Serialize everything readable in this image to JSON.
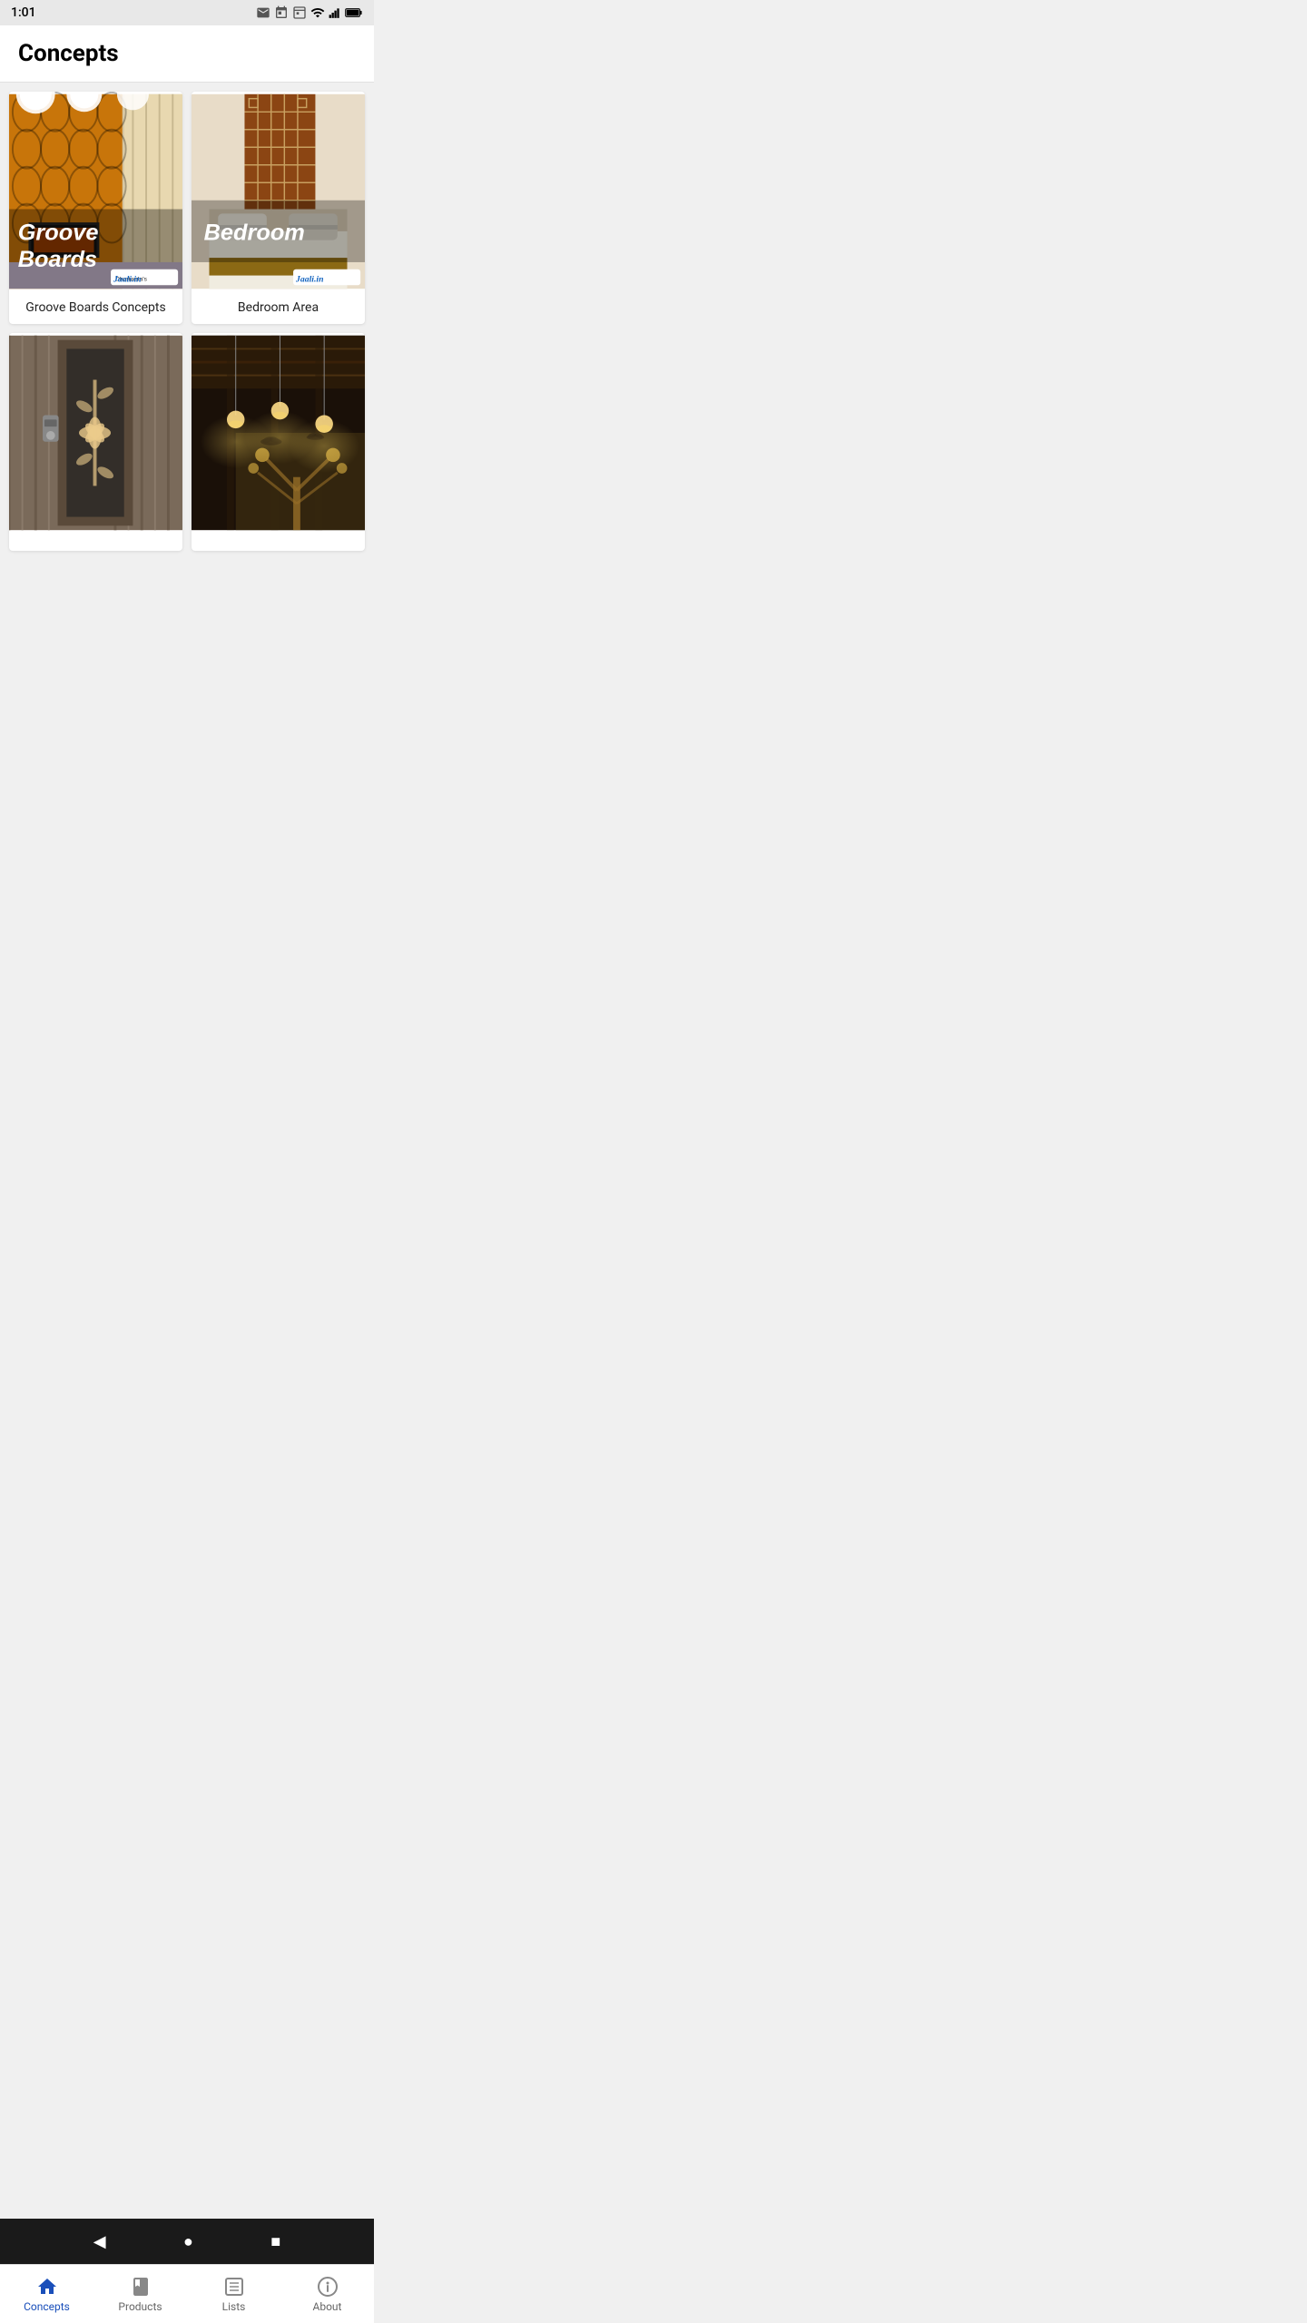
{
  "statusBar": {
    "time": "1:01",
    "icons": [
      "gmail",
      "calendar",
      "calendar2",
      "wifi",
      "signal",
      "battery"
    ]
  },
  "header": {
    "title": "Concepts"
  },
  "cards": [
    {
      "id": "groove-boards",
      "overlayText": "Groove\nBoards",
      "label": "Groove Boards Concepts",
      "badge": "Jaali.in",
      "type": "groove"
    },
    {
      "id": "bedroom-area",
      "overlayText": "Bedroom",
      "label": "Bedroom Area",
      "badge": "Jaali.in",
      "type": "bedroom"
    },
    {
      "id": "door-concept",
      "overlayText": "",
      "label": "",
      "badge": "",
      "type": "door"
    },
    {
      "id": "ceiling-concept",
      "overlayText": "",
      "label": "",
      "badge": "",
      "type": "ceiling"
    }
  ],
  "bottomNav": {
    "items": [
      {
        "id": "concepts",
        "label": "Concepts",
        "active": true
      },
      {
        "id": "products",
        "label": "Products",
        "active": false
      },
      {
        "id": "lists",
        "label": "Lists",
        "active": false
      },
      {
        "id": "about",
        "label": "About",
        "active": false
      }
    ]
  },
  "androidNav": {
    "back": "◀",
    "home": "●",
    "recent": "■"
  }
}
